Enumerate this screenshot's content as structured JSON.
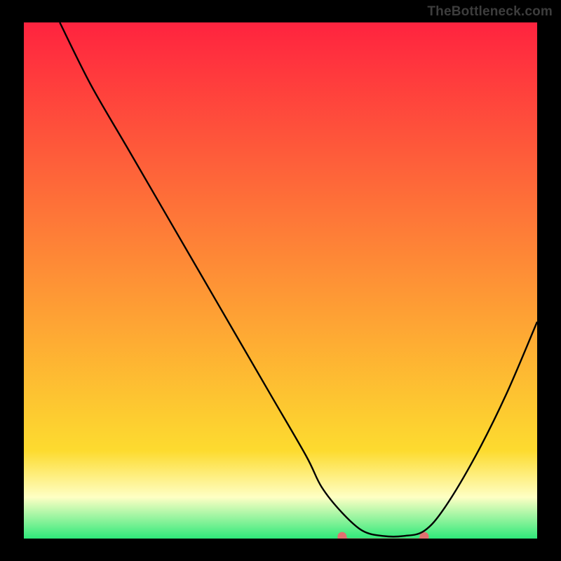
{
  "watermark": "TheBottleneck.com",
  "chart_data": {
    "type": "line",
    "title": "",
    "xlabel": "",
    "ylabel": "",
    "xlim": [
      0,
      100
    ],
    "ylim": [
      0,
      100
    ],
    "background_gradient": {
      "top": "#ff233f",
      "mid": "#fddb2f",
      "bottom": "#2fe97a"
    },
    "series": [
      {
        "name": "curve",
        "color": "#000000",
        "x": [
          7,
          13,
          20,
          27,
          34,
          41,
          48,
          55,
          58,
          62,
          66,
          70,
          74,
          78,
          82,
          88,
          94,
          100
        ],
        "values": [
          100,
          88,
          76,
          64,
          52,
          40,
          28,
          16,
          10,
          5,
          1.5,
          0.5,
          0.5,
          1.5,
          6,
          16,
          28,
          42
        ]
      }
    ],
    "highlight": {
      "name": "trough-band",
      "color": "#e17070",
      "x_start": 62,
      "x_end": 78,
      "y": 0.8
    }
  }
}
